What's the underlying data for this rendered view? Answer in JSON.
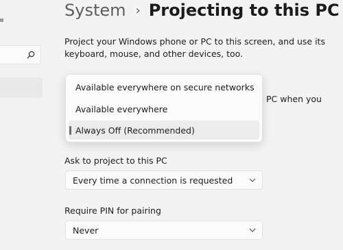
{
  "breadcrumb": {
    "parent": "System",
    "separator": "›",
    "current": "Projecting to this PC"
  },
  "intro": "Project your Windows phone or PC to this screen, and use its keyboard, mouse, and other devices, too.",
  "availability": {
    "side_text": "PC when you",
    "options": [
      "Available everywhere on secure networks",
      "Available everywhere",
      "Always Off (Recommended)"
    ],
    "selected_index": 2
  },
  "ask_to_project": {
    "label": "Ask to project to this PC",
    "value": "Every time a connection is requested"
  },
  "require_pin": {
    "label": "Require PIN for pairing",
    "value": "Never"
  },
  "icons": {
    "search": "search-icon",
    "chevron": "chevron-down-icon"
  }
}
